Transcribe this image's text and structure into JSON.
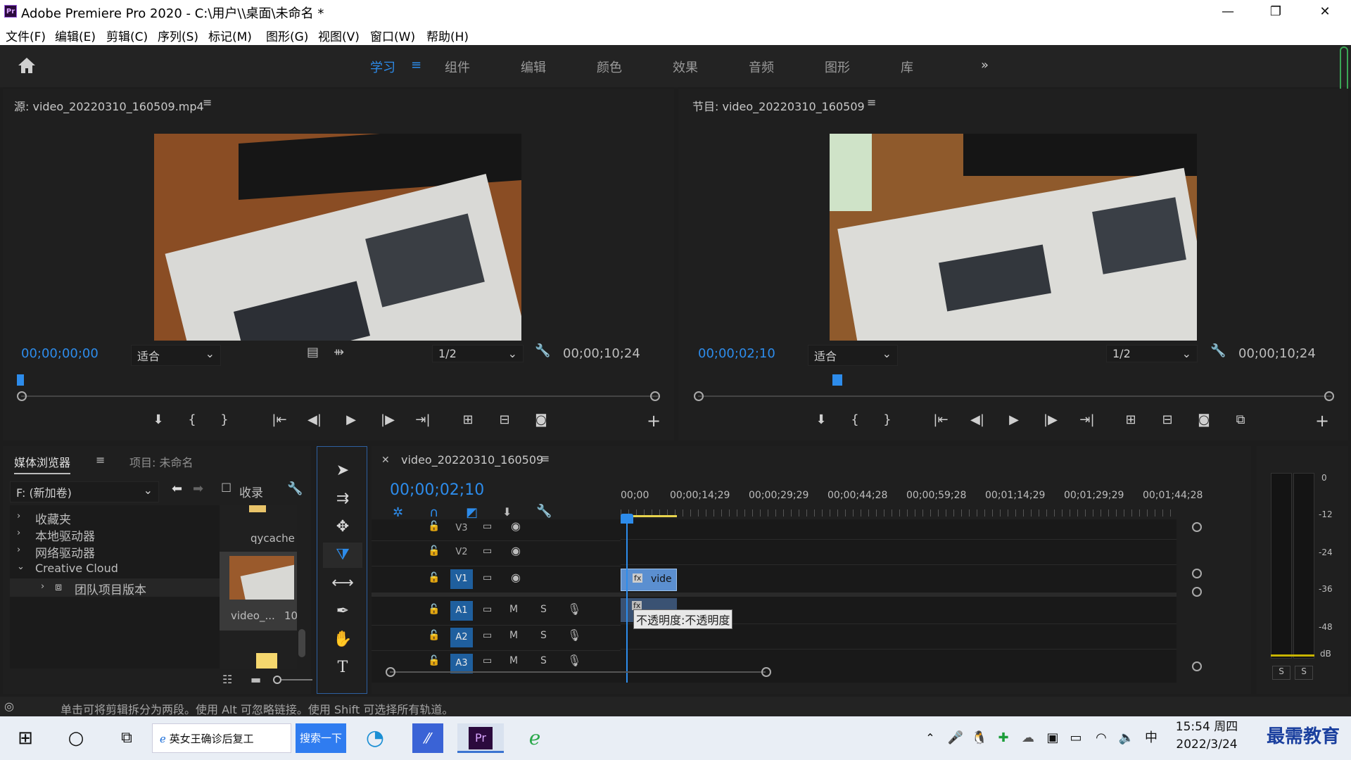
{
  "window": {
    "title": "Adobe Premiere Pro 2020 - C:\\用户\\\\桌面\\未命名 *",
    "logo": "Pr"
  },
  "menu": [
    "文件(F)",
    "编辑(E)",
    "剪辑(C)",
    "序列(S)",
    "标记(M)",
    "图形(G)",
    "视图(V)",
    "窗口(W)",
    "帮助(H)"
  ],
  "workspaces": [
    "学习",
    "组件",
    "编辑",
    "颜色",
    "效果",
    "音频",
    "图形",
    "库"
  ],
  "source": {
    "title": "源: video_20220310_160509.mp4",
    "timecode": "00;00;00;00",
    "fit": "适合",
    "res": "1/2",
    "duration": "00;00;10;24",
    "playhead": 0.0
  },
  "program": {
    "title": "节目: video_20220310_160509",
    "timecode": "00;00;02;10",
    "fit": "适合",
    "res": "1/2",
    "duration": "00;00;10;24",
    "playhead": 0.22
  },
  "media": {
    "tab_active": "媒体浏览器",
    "tab_project": "项目: 未命名",
    "drive": "F: (新加卷)",
    "collect": "收录",
    "tree": [
      "收藏夹",
      "本地驱动器",
      "网络驱动器",
      "Creative Cloud",
      "团队项目版本"
    ],
    "files": [
      {
        "name": "qycache"
      },
      {
        "name": "video_...",
        "extra": "10"
      }
    ]
  },
  "timeline": {
    "title": "video_20220310_160509",
    "timecode": "00;00;02;10",
    "ruler": [
      "00;00",
      "00;00;14;29",
      "00;00;29;29",
      "00;00;44;28",
      "00;00;59;28",
      "00;01;14;29",
      "00;01;29;29",
      "00;01;44;28"
    ],
    "video_tracks": [
      "V3",
      "V2",
      "V1"
    ],
    "audio_tracks": [
      "A1",
      "A2",
      "A3"
    ],
    "clip_label": "vide",
    "tooltip": "不透明度:不透明度",
    "m": "M",
    "s": "S"
  },
  "meter": {
    "scale": [
      "0",
      "-12",
      "-24",
      "-36",
      "-48",
      "dB"
    ],
    "solo": [
      "S",
      "S"
    ]
  },
  "status": "单击可将剪辑拆分为两段。使用 Alt 可忽略链接。使用 Shift 可选择所有轨道。",
  "taskbar": {
    "search_text": "英女王确诊后复工",
    "search_btn": "搜索一下",
    "time": "15:54 周四",
    "date": "2022/3/24",
    "ime": "中",
    "brand": "最需教育"
  },
  "colors": {
    "accent": "#2d8ceb",
    "track_on": "#1f5f9e",
    "clip": "#5b8fd0"
  }
}
